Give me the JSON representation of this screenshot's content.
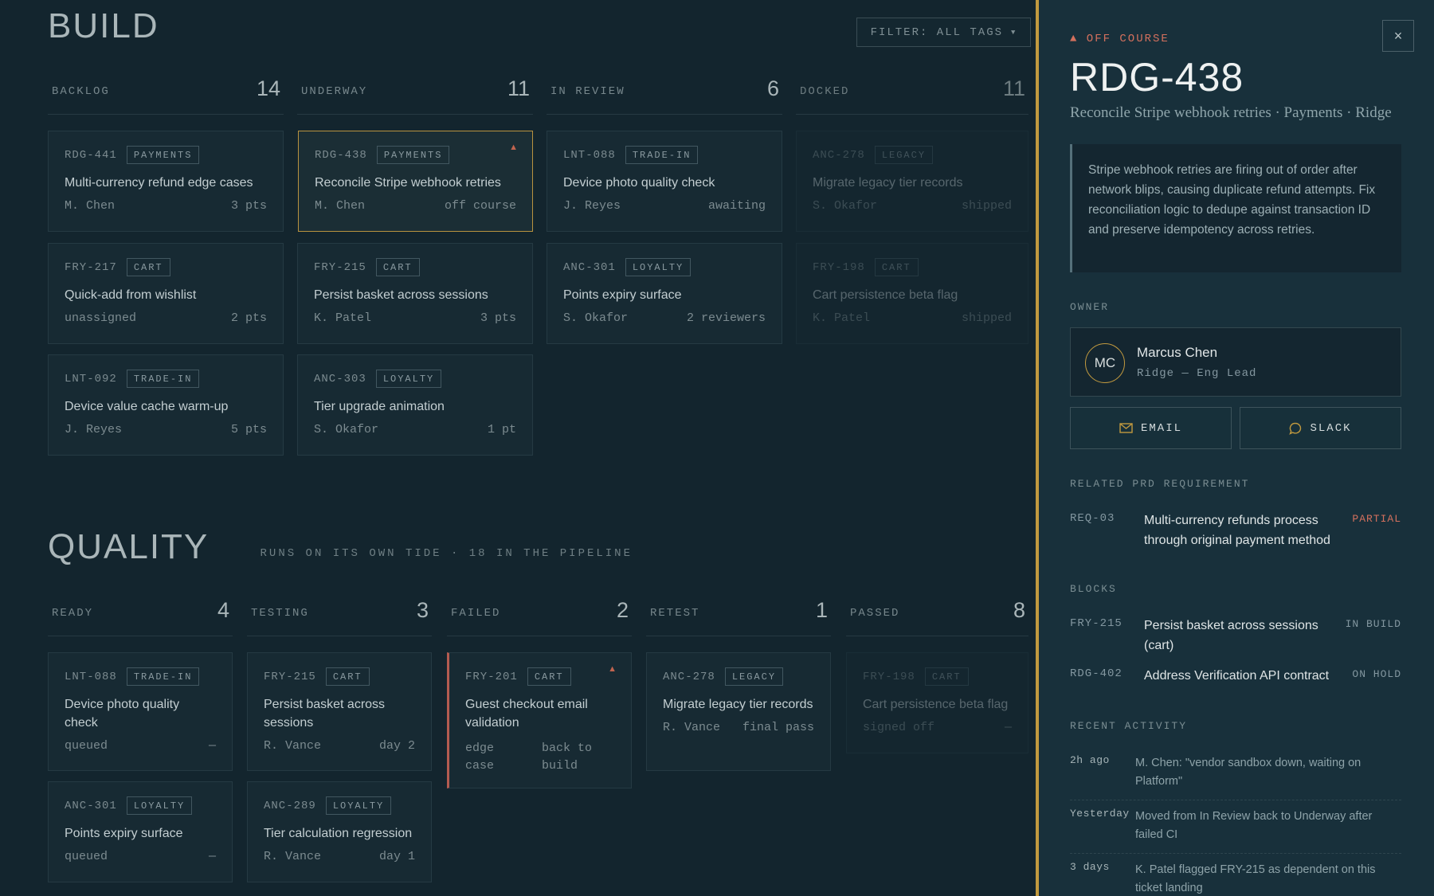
{
  "build": {
    "title": "BUILD",
    "filter_label": "FILTER: ALL TAGS",
    "columns": [
      {
        "name": "BACKLOG",
        "count": "14"
      },
      {
        "name": "UNDERWAY",
        "count": "11"
      },
      {
        "name": "IN REVIEW",
        "count": "6"
      },
      {
        "name": "DOCKED",
        "count": "11"
      }
    ],
    "cards": [
      {
        "id": "RDG-441",
        "tag": "PAYMENTS",
        "title": "Multi-currency refund edge cases",
        "owner": "M. Chen",
        "status": "3 pts"
      },
      {
        "id": "FRY-217",
        "tag": "CART",
        "title": "Quick-add from wishlist",
        "owner": "unassigned",
        "status": "2 pts"
      },
      {
        "id": "LNT-092",
        "tag": "TRADE-IN",
        "title": "Device value cache warm-up",
        "owner": "J. Reyes",
        "status": "5 pts"
      },
      {
        "id": "RDG-438",
        "tag": "PAYMENTS",
        "title": "Reconcile Stripe webhook retries",
        "owner": "M. Chen",
        "status": "off course",
        "warn": "▲"
      },
      {
        "id": "FRY-215",
        "tag": "CART",
        "title": "Persist basket across sessions",
        "owner": "K. Patel",
        "status": "3 pts"
      },
      {
        "id": "ANC-303",
        "tag": "LOYALTY",
        "title": "Tier upgrade animation",
        "owner": "S. Okafor",
        "status": "1 pt"
      },
      {
        "id": "LNT-088",
        "tag": "TRADE-IN",
        "title": "Device photo quality check",
        "owner": "J. Reyes",
        "status": "awaiting"
      },
      {
        "id": "ANC-301",
        "tag": "LOYALTY",
        "title": "Points expiry surface",
        "owner": "S. Okafor",
        "status": "2 reviewers"
      },
      {
        "id": "ANC-278",
        "tag": "LEGACY",
        "title": "Migrate legacy tier records",
        "owner": "S. Okafor",
        "status": "shipped"
      },
      {
        "id": "FRY-198",
        "tag": "CART",
        "title": "Cart persistence beta flag",
        "owner": "K. Patel",
        "status": "shipped"
      }
    ]
  },
  "quality": {
    "title": "QUALITY",
    "note": "RUNS ON ITS OWN TIDE · 18 IN THE PIPELINE",
    "columns": [
      {
        "name": "READY",
        "count": "4"
      },
      {
        "name": "TESTING",
        "count": "3"
      },
      {
        "name": "FAILED",
        "count": "2"
      },
      {
        "name": "RETEST",
        "count": "1"
      },
      {
        "name": "PASSED",
        "count": "8"
      }
    ],
    "cards": [
      {
        "id": "LNT-088",
        "tag": "TRADE-IN",
        "title": "Device photo quality check",
        "owner": "queued",
        "status": "—"
      },
      {
        "id": "ANC-301",
        "tag": "LOYALTY",
        "title": "Points expiry surface",
        "owner": "queued",
        "status": "—"
      },
      {
        "id": "FRY-215",
        "tag": "CART",
        "title": "Persist basket across sessions",
        "owner": "R. Vance",
        "status": "day 2"
      },
      {
        "id": "ANC-289",
        "tag": "LOYALTY",
        "title": "Tier calculation regression",
        "owner": "R. Vance",
        "status": "day 1"
      },
      {
        "id": "FRY-201",
        "tag": "CART",
        "title": "Guest checkout email validation",
        "owner": "edge case",
        "status": "back to build",
        "warn": "▲"
      },
      {
        "id": "ANC-278",
        "tag": "LEGACY",
        "title": "Migrate legacy tier records",
        "owner": "R. Vance",
        "status": "final pass"
      },
      {
        "id": "FRY-198",
        "tag": "CART",
        "title": "Cart persistence beta flag",
        "owner": "signed off",
        "status": "—"
      }
    ]
  },
  "panel": {
    "close": "×",
    "status": "▲ OFF COURSE",
    "id": "RDG-438",
    "subtitle": "Reconcile Stripe webhook retries · Payments · Ridge",
    "description": "Stripe webhook retries are firing out of order after network blips, causing duplicate refund attempts. Fix reconciliation logic to dedupe against transaction ID and preserve idempotency across retries.",
    "owner_label": "OWNER",
    "owner": {
      "initials": "MC",
      "name": "Marcus Chen",
      "role": "Ridge — Eng Lead"
    },
    "email_label": "EMAIL",
    "slack_label": "SLACK",
    "related_label": "RELATED PRD REQUIREMENT",
    "related": {
      "id": "REQ-03",
      "text": "Multi-currency refunds process through original payment method",
      "status": "PARTIAL"
    },
    "blocks_label": "BLOCKS",
    "blocks": [
      {
        "id": "FRY-215",
        "text": "Persist basket across sessions (cart)",
        "status": "IN BUILD"
      },
      {
        "id": "RDG-402",
        "text": "Address Verification API contract",
        "status": "ON HOLD"
      }
    ],
    "activity_label": "RECENT ACTIVITY",
    "activity": [
      {
        "when": "2h ago",
        "what": "M. Chen: \"vendor sandbox down, waiting on Platform\""
      },
      {
        "when": "Yesterday",
        "what": "Moved from In Review back to Underway after failed CI"
      },
      {
        "when": "3 days",
        "what": "K. Patel flagged FRY-215 as dependent on this ticket landing"
      }
    ]
  },
  "colors": {
    "accent": "#c29a3f",
    "warning": "#d3705d",
    "background": "#13252e"
  }
}
